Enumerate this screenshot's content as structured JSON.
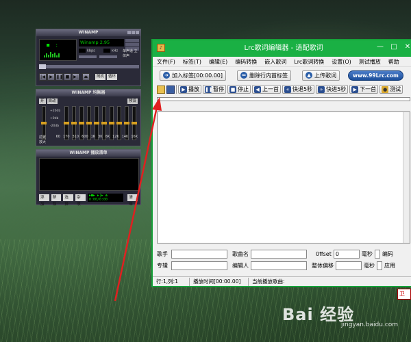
{
  "winamp": {
    "main_title": "WINAMP",
    "song": "Winamp 2.95",
    "kbps": "kbps",
    "khz": "kHz",
    "mode": "单声道 立体声",
    "buttons": [
      "随机",
      "循环"
    ],
    "eq_title": "WINAMP 均衡器",
    "eq_on": "开",
    "eq_auto": "自动",
    "eq_preset": "预设",
    "eq_db_top": "+20db",
    "eq_db_mid": "+0db",
    "eq_db_bot": "-20db",
    "eq_preamp": "前置放大",
    "eq_freqs": [
      "60",
      "170",
      "310",
      "600",
      "1K",
      "3K",
      "6K",
      "12K",
      "14K",
      "16K"
    ],
    "pl_title": "WINAMP 播放清单",
    "pl_add": "添加",
    "pl_rem": "移除",
    "pl_sel": "选择",
    "pl_misc": "杂项",
    "pl_time": "0:00/0:00",
    "pl_list": "清单"
  },
  "lrc": {
    "title": "Lrc歌词编辑器 - 适配歌词",
    "menu": [
      "文件(F)",
      "标签(T)",
      "编辑(E)",
      "编码转换",
      "嵌入歌词",
      "Lrc歌词转换",
      "设置(O)",
      "测试播放",
      "帮助"
    ],
    "add_tag": "加入标签[00:00.00]",
    "del_tag": "删除行内首标签",
    "upload": "上传歌词",
    "url": "www.99Lrc.com",
    "toolbar": [
      "播放",
      "暂停",
      "停止",
      "上一首",
      "快退5秒",
      "快进5秒",
      "下一首",
      "测试"
    ],
    "singer_label": "歌手",
    "song_label": "歌曲名",
    "offset_label": "0ffset",
    "offset_value": "0",
    "ms_label": "毫秒",
    "encode_label": "编码",
    "album_label": "专辑",
    "editor_label": "编辑人",
    "shift_label": "整体偏移",
    "ms_label2": "毫秒",
    "apply_label": "应用",
    "status_pos": "行:1,列:1",
    "status_time": "播放时间[00:00.00]",
    "status_song": "当前播放歌曲:"
  },
  "watermark": {
    "brand": "Bai 经验",
    "site": "jingyan.baidu.com"
  },
  "desktop_icon_right": "卫"
}
